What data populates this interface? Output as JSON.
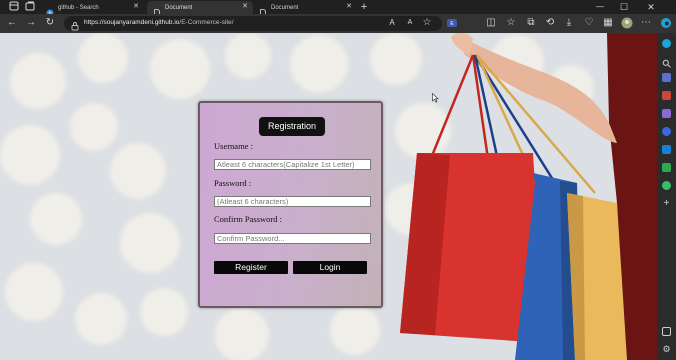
{
  "browser": {
    "tabs": [
      {
        "label": "github - Search",
        "active": false
      },
      {
        "label": "Document",
        "active": true
      },
      {
        "label": "Document",
        "active": false
      }
    ],
    "new_tab": "+",
    "url_host": "https://soujanyaramdeni.github.io",
    "url_path": "/E-Commerce-site/",
    "window_controls": {
      "minimize": "—",
      "maximize": "☐",
      "close": "✕"
    }
  },
  "form": {
    "title": "Registration",
    "username_label": "Username :",
    "username_placeholder": "Atleast 6 characters(Capitalize 1st Letter)",
    "password_label": "Password :",
    "password_placeholder": "(Atleast 6 characters)",
    "confirm_label": "Confirm Password :",
    "confirm_placeholder": "Confirm Password...",
    "register_label": "Register",
    "login_label": "Login"
  },
  "colors": {
    "card_border": "#6b5a63",
    "button_bg": "#080808",
    "bag_red": "#d9332f",
    "bag_blue": "#2f63b7",
    "bag_yellow": "#e9b95c"
  }
}
